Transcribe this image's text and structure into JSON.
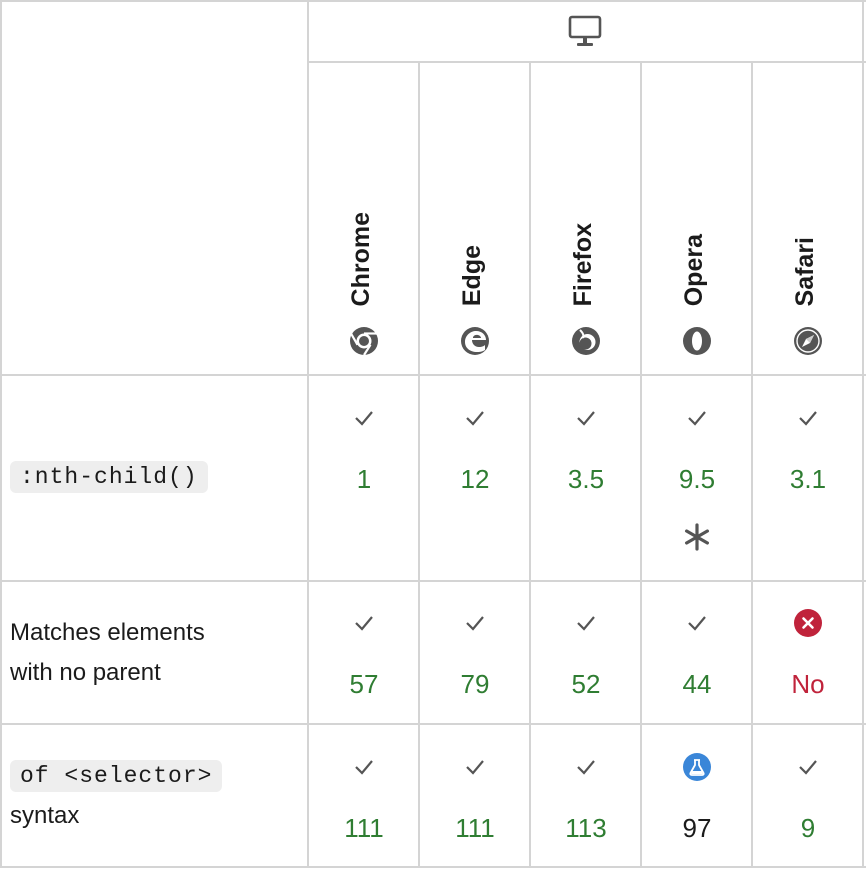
{
  "header": {
    "platform_icon": "desktop-icon",
    "browsers": [
      {
        "name": "Chrome",
        "icon": "chrome-icon"
      },
      {
        "name": "Edge",
        "icon": "edge-icon"
      },
      {
        "name": "Firefox",
        "icon": "firefox-icon"
      },
      {
        "name": "Opera",
        "icon": "opera-icon"
      },
      {
        "name": "Safari",
        "icon": "safari-icon"
      }
    ]
  },
  "rows": [
    {
      "feature": ":nth-child()",
      "feature_is_code": true,
      "cells": [
        {
          "version": "1",
          "status": "supported"
        },
        {
          "version": "12",
          "status": "supported"
        },
        {
          "version": "3.5",
          "status": "supported"
        },
        {
          "version": "9.5",
          "status": "supported",
          "note_icon": "asterisk-icon"
        },
        {
          "version": "3.1",
          "status": "supported"
        }
      ]
    },
    {
      "feature_line1": "Matches elements",
      "feature_line2": "with no parent",
      "cells": [
        {
          "version": "57",
          "status": "supported"
        },
        {
          "version": "79",
          "status": "supported"
        },
        {
          "version": "52",
          "status": "supported"
        },
        {
          "version": "44",
          "status": "supported"
        },
        {
          "version": "No",
          "status": "unsupported"
        }
      ]
    },
    {
      "feature_code": "of <selector>",
      "feature_text": "syntax",
      "cells": [
        {
          "version": "111",
          "status": "supported"
        },
        {
          "version": "111",
          "status": "supported"
        },
        {
          "version": "113",
          "status": "supported"
        },
        {
          "version": "97",
          "status": "experimental"
        },
        {
          "version": "9",
          "status": "supported"
        }
      ]
    }
  ],
  "colors": {
    "supported": "#2f7d32",
    "unsupported": "#c0233b",
    "experimental": "#3a86d8",
    "border": "#d4d4d4"
  }
}
